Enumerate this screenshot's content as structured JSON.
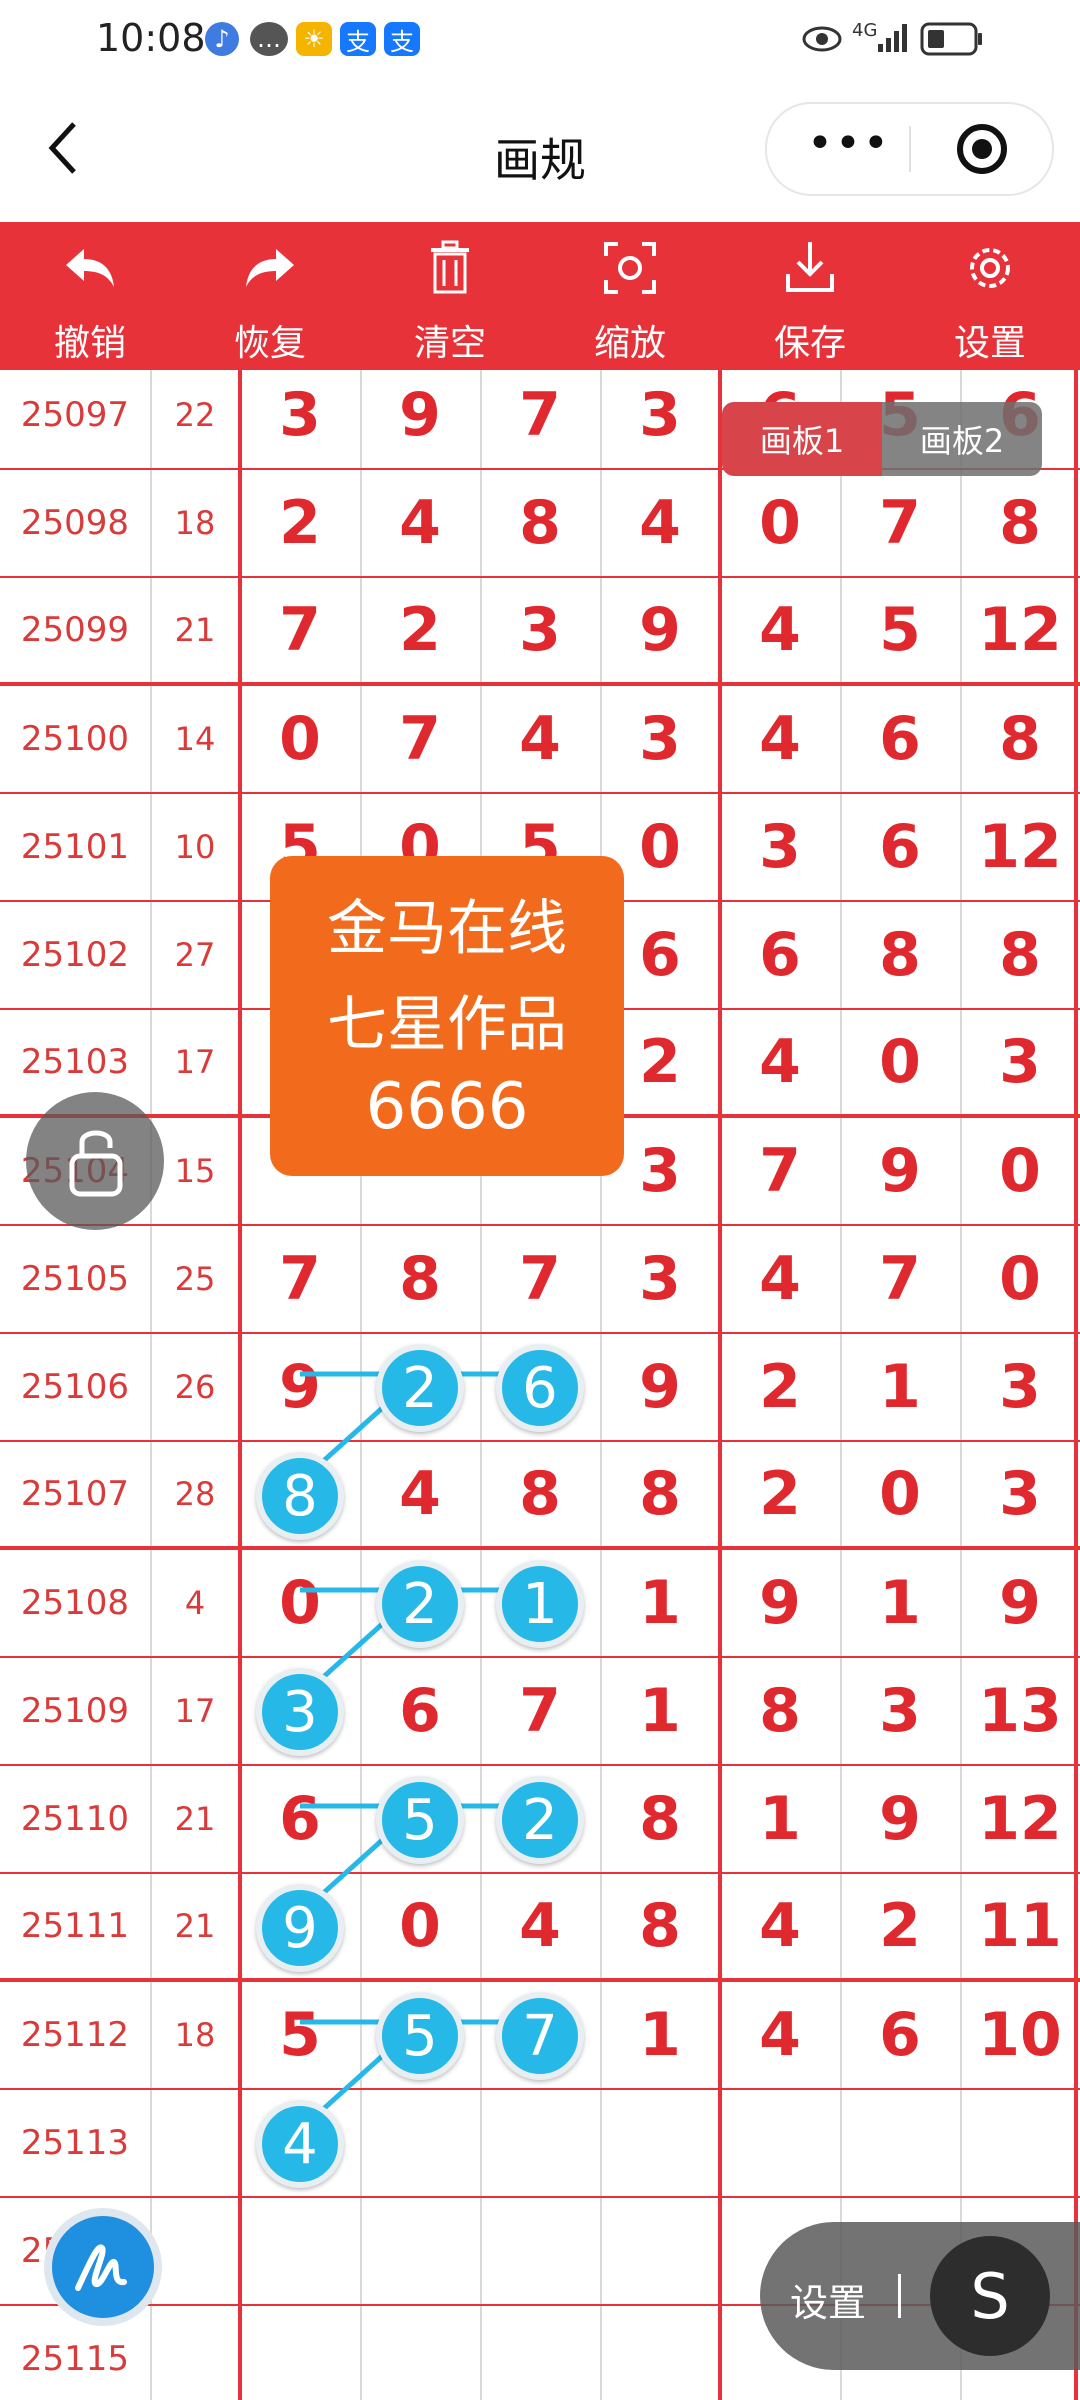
{
  "status_bar": {
    "time": "10:08",
    "network": "4G"
  },
  "title_bar": {
    "title": "画规",
    "more": "•••"
  },
  "toolbar": [
    {
      "label": "撤销",
      "icon": "undo-icon"
    },
    {
      "label": "恢复",
      "icon": "redo-icon"
    },
    {
      "label": "清空",
      "icon": "trash-icon"
    },
    {
      "label": "缩放",
      "icon": "zoom-icon"
    },
    {
      "label": "保存",
      "icon": "download-icon"
    },
    {
      "label": "设置",
      "icon": "gear-icon"
    }
  ],
  "board_tabs": [
    "画板1",
    "画板2"
  ],
  "rows": [
    {
      "period": "25097",
      "sum": "22",
      "digits": [
        "3",
        "9",
        "7",
        "3",
        "6",
        "5",
        "6"
      ]
    },
    {
      "period": "25098",
      "sum": "18",
      "digits": [
        "2",
        "4",
        "8",
        "4",
        "0",
        "7",
        "8"
      ]
    },
    {
      "period": "25099",
      "sum": "21",
      "digits": [
        "7",
        "2",
        "3",
        "9",
        "4",
        "5",
        "12"
      ]
    },
    {
      "period": "25100",
      "sum": "14",
      "digits": [
        "0",
        "7",
        "4",
        "3",
        "4",
        "6",
        "8"
      ]
    },
    {
      "period": "25101",
      "sum": "10",
      "digits": [
        "5",
        "0",
        "5",
        "0",
        "3",
        "6",
        "12"
      ]
    },
    {
      "period": "25102",
      "sum": "27",
      "digits": [
        "",
        "",
        "",
        "6",
        "6",
        "8",
        "8"
      ]
    },
    {
      "period": "25103",
      "sum": "17",
      "digits": [
        "",
        "",
        "",
        "2",
        "4",
        "0",
        "3"
      ]
    },
    {
      "period": "25104",
      "sum": "15",
      "digits": [
        "",
        "",
        "",
        "3",
        "7",
        "9",
        "0"
      ]
    },
    {
      "period": "25105",
      "sum": "25",
      "digits": [
        "7",
        "8",
        "7",
        "3",
        "4",
        "7",
        "0"
      ]
    },
    {
      "period": "25106",
      "sum": "26",
      "digits": [
        "9",
        "",
        "",
        "9",
        "2",
        "1",
        "3"
      ]
    },
    {
      "period": "25107",
      "sum": "28",
      "digits": [
        "",
        "4",
        "8",
        "8",
        "2",
        "0",
        "3"
      ]
    },
    {
      "period": "25108",
      "sum": "4",
      "digits": [
        "0",
        "",
        "",
        "1",
        "9",
        "1",
        "9"
      ]
    },
    {
      "period": "25109",
      "sum": "17",
      "digits": [
        "",
        "6",
        "7",
        "1",
        "8",
        "3",
        "13"
      ]
    },
    {
      "period": "25110",
      "sum": "21",
      "digits": [
        "6",
        "",
        "",
        "8",
        "1",
        "9",
        "12"
      ]
    },
    {
      "period": "25111",
      "sum": "21",
      "digits": [
        "",
        "0",
        "4",
        "8",
        "4",
        "2",
        "11"
      ]
    },
    {
      "period": "25112",
      "sum": "18",
      "digits": [
        "5",
        "",
        "",
        "1",
        "4",
        "6",
        "10"
      ]
    },
    {
      "period": "25113",
      "sum": "",
      "digits": [
        "",
        "",
        "",
        "",
        "",
        "",
        ""
      ]
    },
    {
      "period": "25114",
      "sum": "",
      "digits": [
        "",
        "",
        "",
        "",
        "",
        "",
        ""
      ]
    },
    {
      "period": "25115",
      "sum": "",
      "digits": [
        "",
        "",
        "",
        "",
        "",
        "",
        ""
      ]
    }
  ],
  "markers": [
    {
      "row": 9,
      "col": 1,
      "value": "2"
    },
    {
      "row": 9,
      "col": 2,
      "value": "6"
    },
    {
      "row": 10,
      "col": 0,
      "value": "8"
    },
    {
      "row": 11,
      "col": 1,
      "value": "2"
    },
    {
      "row": 11,
      "col": 2,
      "value": "1"
    },
    {
      "row": 12,
      "col": 0,
      "value": "3"
    },
    {
      "row": 13,
      "col": 1,
      "value": "5"
    },
    {
      "row": 13,
      "col": 2,
      "value": "2"
    },
    {
      "row": 14,
      "col": 0,
      "value": "9"
    },
    {
      "row": 15,
      "col": 1,
      "value": "5"
    },
    {
      "row": 15,
      "col": 2,
      "value": "7"
    },
    {
      "row": 16,
      "col": 0,
      "value": "4"
    }
  ],
  "watermark": {
    "line1": "金马在线",
    "line2": "七星作品",
    "line3": "6666"
  },
  "fab": {
    "label": "设置",
    "button": "S"
  },
  "colors": {
    "accent": "#e8323a",
    "marker": "#26b9e8",
    "watermark_bg": "#f26a1b"
  }
}
